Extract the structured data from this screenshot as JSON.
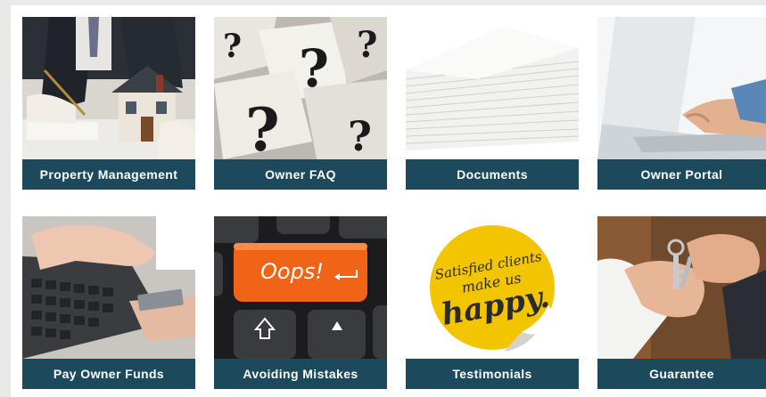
{
  "tiles": [
    {
      "label": "Property Management",
      "image_icon": "house-model-icon"
    },
    {
      "label": "Owner FAQ",
      "image_icon": "question-marks-icon"
    },
    {
      "label": "Documents",
      "image_icon": "paper-stack-icon"
    },
    {
      "label": "Owner Portal",
      "image_icon": "laptop-typing-icon"
    },
    {
      "label": "Pay Owner Funds",
      "image_icon": "keyboard-card-icon"
    },
    {
      "label": "Avoiding Mistakes",
      "image_icon": "oops-key-icon"
    },
    {
      "label": "Testimonials",
      "image_icon": "satisfied-sticker-icon"
    },
    {
      "label": "Guarantee",
      "image_icon": "handshake-keys-icon"
    }
  ],
  "sticker_text": {
    "line1": "Satisfied clients",
    "line2": "make us",
    "line3": "happy."
  },
  "key_text": "Oops!",
  "colors": {
    "label_bg": "#1c4a5c",
    "label_text": "#ffffff",
    "frame_bg": "#e9e9e7",
    "sticker": "#f3c400",
    "oops_key": "#f06418"
  }
}
